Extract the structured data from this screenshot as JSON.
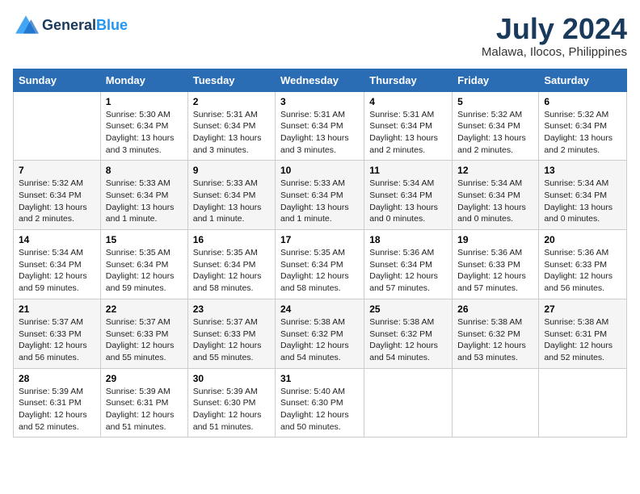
{
  "header": {
    "logo_line1": "General",
    "logo_line2": "Blue",
    "title": "July 2024",
    "location": "Malawa, Ilocos, Philippines"
  },
  "columns": [
    "Sunday",
    "Monday",
    "Tuesday",
    "Wednesday",
    "Thursday",
    "Friday",
    "Saturday"
  ],
  "weeks": [
    [
      {
        "day": "",
        "info": ""
      },
      {
        "day": "1",
        "info": "Sunrise: 5:30 AM\nSunset: 6:34 PM\nDaylight: 13 hours\nand 3 minutes."
      },
      {
        "day": "2",
        "info": "Sunrise: 5:31 AM\nSunset: 6:34 PM\nDaylight: 13 hours\nand 3 minutes."
      },
      {
        "day": "3",
        "info": "Sunrise: 5:31 AM\nSunset: 6:34 PM\nDaylight: 13 hours\nand 3 minutes."
      },
      {
        "day": "4",
        "info": "Sunrise: 5:31 AM\nSunset: 6:34 PM\nDaylight: 13 hours\nand 2 minutes."
      },
      {
        "day": "5",
        "info": "Sunrise: 5:32 AM\nSunset: 6:34 PM\nDaylight: 13 hours\nand 2 minutes."
      },
      {
        "day": "6",
        "info": "Sunrise: 5:32 AM\nSunset: 6:34 PM\nDaylight: 13 hours\nand 2 minutes."
      }
    ],
    [
      {
        "day": "7",
        "info": "Sunrise: 5:32 AM\nSunset: 6:34 PM\nDaylight: 13 hours\nand 2 minutes."
      },
      {
        "day": "8",
        "info": "Sunrise: 5:33 AM\nSunset: 6:34 PM\nDaylight: 13 hours\nand 1 minute."
      },
      {
        "day": "9",
        "info": "Sunrise: 5:33 AM\nSunset: 6:34 PM\nDaylight: 13 hours\nand 1 minute."
      },
      {
        "day": "10",
        "info": "Sunrise: 5:33 AM\nSunset: 6:34 PM\nDaylight: 13 hours\nand 1 minute."
      },
      {
        "day": "11",
        "info": "Sunrise: 5:34 AM\nSunset: 6:34 PM\nDaylight: 13 hours\nand 0 minutes."
      },
      {
        "day": "12",
        "info": "Sunrise: 5:34 AM\nSunset: 6:34 PM\nDaylight: 13 hours\nand 0 minutes."
      },
      {
        "day": "13",
        "info": "Sunrise: 5:34 AM\nSunset: 6:34 PM\nDaylight: 13 hours\nand 0 minutes."
      }
    ],
    [
      {
        "day": "14",
        "info": "Sunrise: 5:34 AM\nSunset: 6:34 PM\nDaylight: 12 hours\nand 59 minutes."
      },
      {
        "day": "15",
        "info": "Sunrise: 5:35 AM\nSunset: 6:34 PM\nDaylight: 12 hours\nand 59 minutes."
      },
      {
        "day": "16",
        "info": "Sunrise: 5:35 AM\nSunset: 6:34 PM\nDaylight: 12 hours\nand 58 minutes."
      },
      {
        "day": "17",
        "info": "Sunrise: 5:35 AM\nSunset: 6:34 PM\nDaylight: 12 hours\nand 58 minutes."
      },
      {
        "day": "18",
        "info": "Sunrise: 5:36 AM\nSunset: 6:34 PM\nDaylight: 12 hours\nand 57 minutes."
      },
      {
        "day": "19",
        "info": "Sunrise: 5:36 AM\nSunset: 6:33 PM\nDaylight: 12 hours\nand 57 minutes."
      },
      {
        "day": "20",
        "info": "Sunrise: 5:36 AM\nSunset: 6:33 PM\nDaylight: 12 hours\nand 56 minutes."
      }
    ],
    [
      {
        "day": "21",
        "info": "Sunrise: 5:37 AM\nSunset: 6:33 PM\nDaylight: 12 hours\nand 56 minutes."
      },
      {
        "day": "22",
        "info": "Sunrise: 5:37 AM\nSunset: 6:33 PM\nDaylight: 12 hours\nand 55 minutes."
      },
      {
        "day": "23",
        "info": "Sunrise: 5:37 AM\nSunset: 6:33 PM\nDaylight: 12 hours\nand 55 minutes."
      },
      {
        "day": "24",
        "info": "Sunrise: 5:38 AM\nSunset: 6:32 PM\nDaylight: 12 hours\nand 54 minutes."
      },
      {
        "day": "25",
        "info": "Sunrise: 5:38 AM\nSunset: 6:32 PM\nDaylight: 12 hours\nand 54 minutes."
      },
      {
        "day": "26",
        "info": "Sunrise: 5:38 AM\nSunset: 6:32 PM\nDaylight: 12 hours\nand 53 minutes."
      },
      {
        "day": "27",
        "info": "Sunrise: 5:38 AM\nSunset: 6:31 PM\nDaylight: 12 hours\nand 52 minutes."
      }
    ],
    [
      {
        "day": "28",
        "info": "Sunrise: 5:39 AM\nSunset: 6:31 PM\nDaylight: 12 hours\nand 52 minutes."
      },
      {
        "day": "29",
        "info": "Sunrise: 5:39 AM\nSunset: 6:31 PM\nDaylight: 12 hours\nand 51 minutes."
      },
      {
        "day": "30",
        "info": "Sunrise: 5:39 AM\nSunset: 6:30 PM\nDaylight: 12 hours\nand 51 minutes."
      },
      {
        "day": "31",
        "info": "Sunrise: 5:40 AM\nSunset: 6:30 PM\nDaylight: 12 hours\nand 50 minutes."
      },
      {
        "day": "",
        "info": ""
      },
      {
        "day": "",
        "info": ""
      },
      {
        "day": "",
        "info": ""
      }
    ]
  ]
}
